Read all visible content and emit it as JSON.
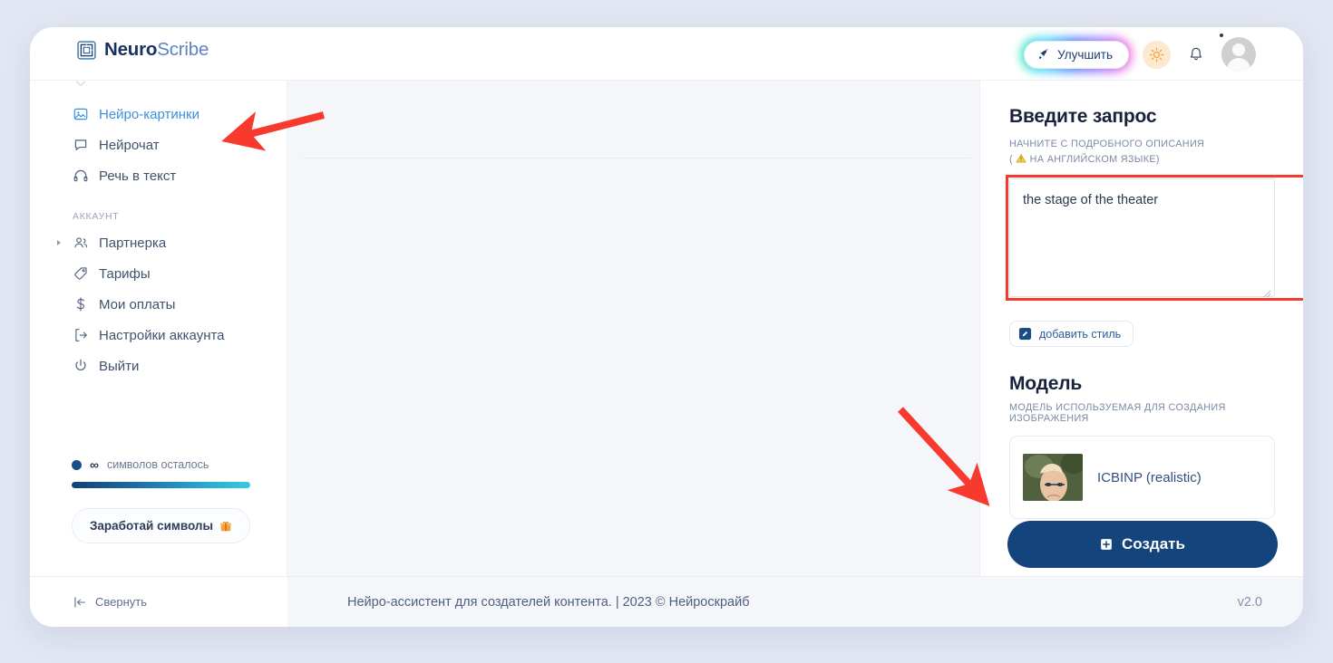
{
  "brand": {
    "name_bold": "Neuro",
    "name_light": "Scribe",
    "logo_icon": "spiral-square-logo-icon"
  },
  "header": {
    "improve_label": "Улучшить",
    "improve_icon": "rocket-icon",
    "theme_icon": "sun-icon",
    "notifications_icon": "bell-icon",
    "avatar_icon": "user-avatar-icon",
    "accent_glow": "#4b7bff"
  },
  "sidebar": {
    "items": [
      {
        "label": "Нейро-картинки",
        "icon": "image-icon",
        "active": true
      },
      {
        "label": "Нейрочат",
        "icon": "chat-bubble-icon",
        "active": false
      },
      {
        "label": "Речь в текст",
        "icon": "headphones-icon",
        "active": false
      }
    ],
    "section_label": "АККАУНТ",
    "account_items": [
      {
        "label": "Партнерка",
        "icon": "users-icon",
        "has_caret": true
      },
      {
        "label": "Тарифы",
        "icon": "tag-icon",
        "has_caret": false
      },
      {
        "label": "Мои оплаты",
        "icon": "dollar-icon",
        "has_caret": false
      },
      {
        "label": "Настройки аккаунта",
        "icon": "logout-bracket-icon",
        "has_caret": false
      },
      {
        "label": "Выйти",
        "icon": "power-icon",
        "has_caret": false
      }
    ],
    "quota": {
      "amount": "∞",
      "label": "символов осталось",
      "bar_fill_percent": 100,
      "bar_from": "#123f73",
      "bar_to": "#35cbe3"
    },
    "earn_button": {
      "label": "Заработай символы",
      "icon": "gift-icon"
    },
    "collapse": {
      "label": "Свернуть",
      "icon": "collapse-left-icon"
    }
  },
  "right_panel": {
    "prompt_title": "Введите запрос",
    "prompt_hint_line1": "НАЧНИТЕ С ПОДРОБНОГО ОПИСАНИЯ",
    "prompt_hint_line2_prefix": "(",
    "prompt_hint_line2": "НА АНГЛИЙСКОМ ЯЗЫКЕ)",
    "prompt_hint_icon": "warning-triangle-icon",
    "prompt_value": "the stage of the theater",
    "prompt_placeholder": "",
    "style_button": {
      "label": "добавить стиль",
      "icon": "edit-pencil-icon"
    },
    "model_title": "Модель",
    "model_subtitle": "МОДЕЛЬ ИСПОЛЬЗУЕМАЯ ДЛЯ СОЗДАНИЯ ИЗОБРАЖЕНИЯ",
    "model_selected": {
      "name": "ICBINP (realistic)",
      "thumb": "portrait-thumbnail"
    }
  },
  "create_button": {
    "label": "Создать",
    "icon": "plus-square-icon",
    "color": "#14447c"
  },
  "footer": {
    "text": "Нейро-ассистент для создателей контента.  | 2023 © Нейроскрайб",
    "version": "v2.0"
  },
  "annotations": {
    "color": "#f83a2e",
    "highlight_box_target": "prompt-textarea",
    "arrow_1_target": "sidebar-item-neuro-pictures",
    "arrow_2_target": "create-button"
  }
}
